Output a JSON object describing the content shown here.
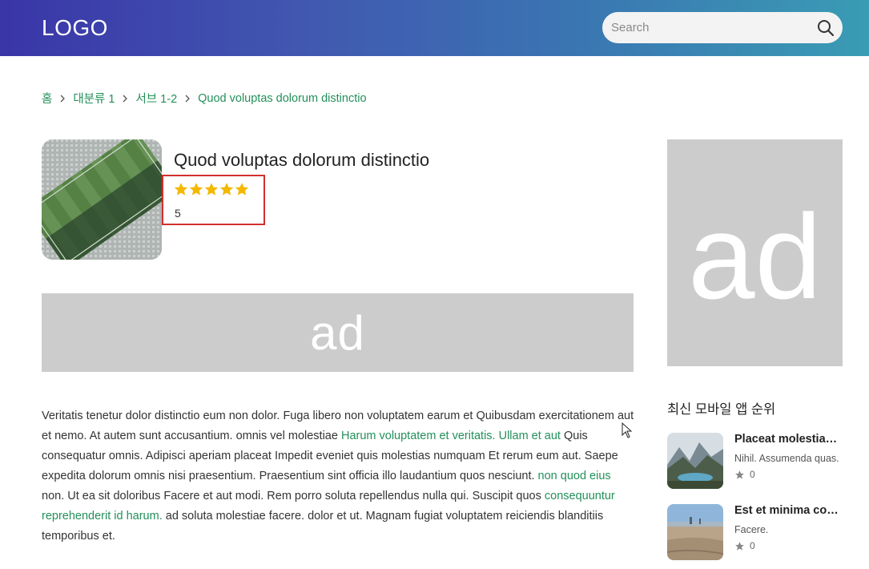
{
  "header": {
    "logo": "LOGO",
    "search": {
      "placeholder": "Search",
      "value": ""
    }
  },
  "breadcrumb": [
    "홈",
    "대분류 1",
    "서브 1-2",
    "Quod voluptas dolorum distinctio"
  ],
  "product": {
    "title": "Quod voluptas dolorum distinctio",
    "rating": 5,
    "rating_text": "5",
    "star_count": 5
  },
  "ads": {
    "banner": "ad",
    "side": "ad"
  },
  "description": {
    "p1": "Veritatis tenetur dolor distinctio eum non dolor. Fuga libero non voluptatem earum et Quibusdam exercitationem aut et nemo. At autem sunt accusantium. omnis vel molestiae ",
    "link1": "Harum voluptatem et veritatis. Ullam et aut",
    "p2": " Quis consequatur omnis. Adipisci aperiam placeat Impedit eveniet quis molestias numquam Et rerum eum aut. Saepe expedita dolorum omnis nisi praesentium. Praesentium sint officia illo laudantium quos nesciunt. ",
    "link2": "non quod eius",
    "p3": " non. Ut ea sit doloribus Facere et aut modi. Rem porro soluta repellendus nulla qui. Suscipit quos ",
    "link3": "consequuntur reprehenderit id harum.",
    "p4": " ad soluta molestiae facere. dolor et ut. Magnam fugiat voluptatem reiciendis blanditiis temporibus et."
  },
  "ranking": {
    "title": "최신 모바일 앱 순위",
    "items": [
      {
        "name": "Placeat molestias cupiditate",
        "subtitle": "Nihil. Assumenda quas.",
        "rating": "0"
      },
      {
        "name": "Est et minima consequatur",
        "subtitle": "Facere.",
        "rating": "0"
      }
    ]
  },
  "colors": {
    "accent": "#23905a",
    "star": "#f5b800",
    "highlight_border": "#d32f2f",
    "ad_bg": "#cccccc"
  }
}
